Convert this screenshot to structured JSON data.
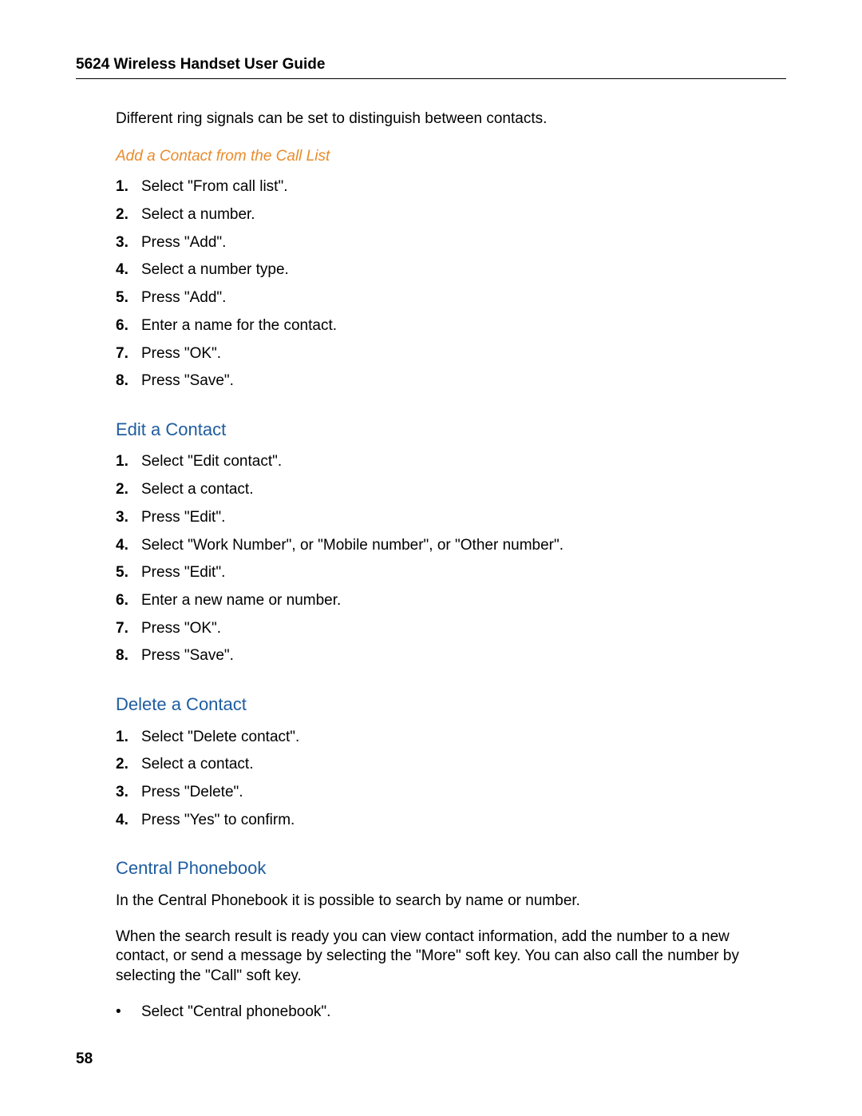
{
  "header": {
    "title": "5624 Wireless Handset User Guide"
  },
  "content": {
    "intro": "Different ring signals can be set to distinguish between contacts.",
    "section1": {
      "heading": "Add a Contact from the Call List",
      "steps": [
        "Select \"From call list\".",
        "Select a number.",
        "Press \"Add\".",
        "Select a number type.",
        "Press \"Add\".",
        "Enter a name for the contact.",
        "Press \"OK\".",
        "Press \"Save\"."
      ]
    },
    "section2": {
      "heading": "Edit a Contact",
      "steps": [
        "Select \"Edit contact\".",
        "Select a contact.",
        "Press \"Edit\".",
        "Select \"Work Number\", or \"Mobile number\", or \"Other number\".",
        "Press \"Edit\".",
        "Enter a new name or number.",
        "Press \"OK\".",
        "Press \"Save\"."
      ]
    },
    "section3": {
      "heading": "Delete a Contact",
      "steps": [
        "Select \"Delete contact\".",
        "Select a contact.",
        "Press \"Delete\".",
        "Press \"Yes\" to confirm."
      ]
    },
    "section4": {
      "heading": "Central Phonebook",
      "para1": "In the Central Phonebook it is possible to search by name or number.",
      "para2": "When the search result is ready you can view contact information, add the number to a new contact, or send a message by selecting the \"More\" soft key. You can also call the number by selecting the \"Call\" soft key.",
      "bullets": [
        "Select \"Central phonebook\"."
      ]
    }
  },
  "pageNumber": "58"
}
